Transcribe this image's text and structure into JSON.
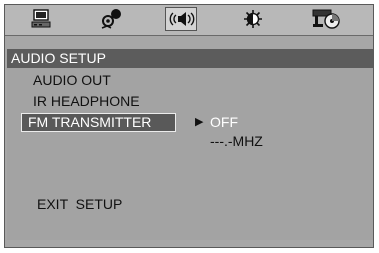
{
  "icons": [
    {
      "name": "general-setup-icon",
      "active": false
    },
    {
      "name": "speaker-setup-icon",
      "active": false
    },
    {
      "name": "audio-setup-icon",
      "active": true
    },
    {
      "name": "video-setup-icon",
      "active": false
    },
    {
      "name": "preference-setup-icon",
      "active": false
    }
  ],
  "menu": {
    "title": "AUDIO SETUP",
    "items": [
      "AUDIO OUT",
      "IR HEADPHONE",
      "FM TRANSMITTER"
    ],
    "selected_index": 2,
    "exit_label": "EXIT  SETUP"
  },
  "submenu": {
    "arrow": "▶",
    "options": [
      "OFF",
      "---.-MHZ"
    ]
  },
  "colors": {
    "frame": "#a7a7a7",
    "title_bar": "#5c5c5c",
    "highlight": "#595959"
  }
}
